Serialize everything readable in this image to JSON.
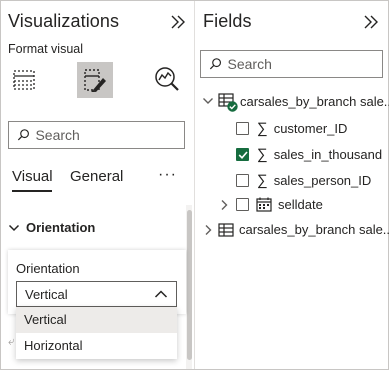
{
  "visualizations": {
    "title": "Visualizations",
    "collapse_icon": "double-chevron-right-icon",
    "format_label": "Format visual",
    "icon_tabs": [
      {
        "name": "build-visual-icon"
      },
      {
        "name": "format-visual-icon",
        "selected": true
      },
      {
        "name": "analytics-icon"
      }
    ],
    "search": {
      "placeholder": "Search"
    },
    "tabs": [
      "Visual",
      "General"
    ],
    "more_label": "···",
    "section": {
      "label": "Orientation"
    },
    "card": {
      "label": "Orientation",
      "selected_value": "Vertical",
      "options": [
        "Vertical",
        "Horizontal"
      ]
    }
  },
  "fields": {
    "title": "Fields",
    "collapse_icon": "double-chevron-right-icon",
    "search": {
      "placeholder": "Search"
    },
    "tables": [
      {
        "name": "carsales_by_branch sale...",
        "expanded": true,
        "has_check_badge": true,
        "fields": [
          {
            "name": "customer_ID",
            "type": "sigma",
            "checked": false
          },
          {
            "name": "sales_in_thousand",
            "type": "sigma",
            "checked": true
          },
          {
            "name": "sales_person_ID",
            "type": "sigma",
            "checked": false
          },
          {
            "name": "selldate",
            "type": "calendar",
            "checked": false,
            "expandable": true
          }
        ]
      },
      {
        "name": "carsales_by_branch sale...",
        "expanded": false
      }
    ]
  },
  "colors": {
    "accent_green": "#166c3f",
    "selected_tab_bg": "#c8c6c4",
    "text": "#252423",
    "border": "#8a8886"
  }
}
